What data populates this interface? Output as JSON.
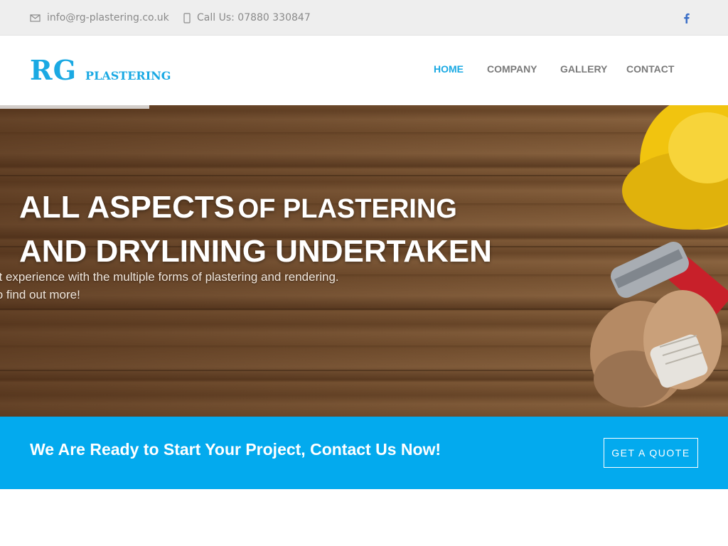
{
  "topbar": {
    "email": "info@rg-plastering.co.uk",
    "phone": "Call Us: 07880 330847",
    "email_icon": "envelope-icon",
    "phone_icon": "phone-icon",
    "social_icon": "facebook-icon"
  },
  "logo": {
    "initials": "RG",
    "word": "PLASTERING"
  },
  "nav": {
    "items": [
      {
        "label": "HOME",
        "active": true
      },
      {
        "label": "COMPANY",
        "active": false
      },
      {
        "label": "GALLERY",
        "active": false
      },
      {
        "label": "CONTACT",
        "active": false
      }
    ]
  },
  "hero": {
    "title_part1": "ALL ASPECTS",
    "title_part2": "OF PLASTERING",
    "title_line2": "AND DRYLINING UNDERTAKEN",
    "subtitle_line1": "st experience with the multiple forms of plastering and rendering.",
    "subtitle_line2": "to find out more!"
  },
  "cta": {
    "text": "We Are Ready to Start Your Project, Contact Us Now!",
    "button_label": "GET A QUOTE"
  },
  "colors": {
    "accent": "#1aa9e3",
    "cta_background": "#03aaee",
    "topbar_background": "#eeeeee",
    "nav_text": "#7a7a7a"
  }
}
